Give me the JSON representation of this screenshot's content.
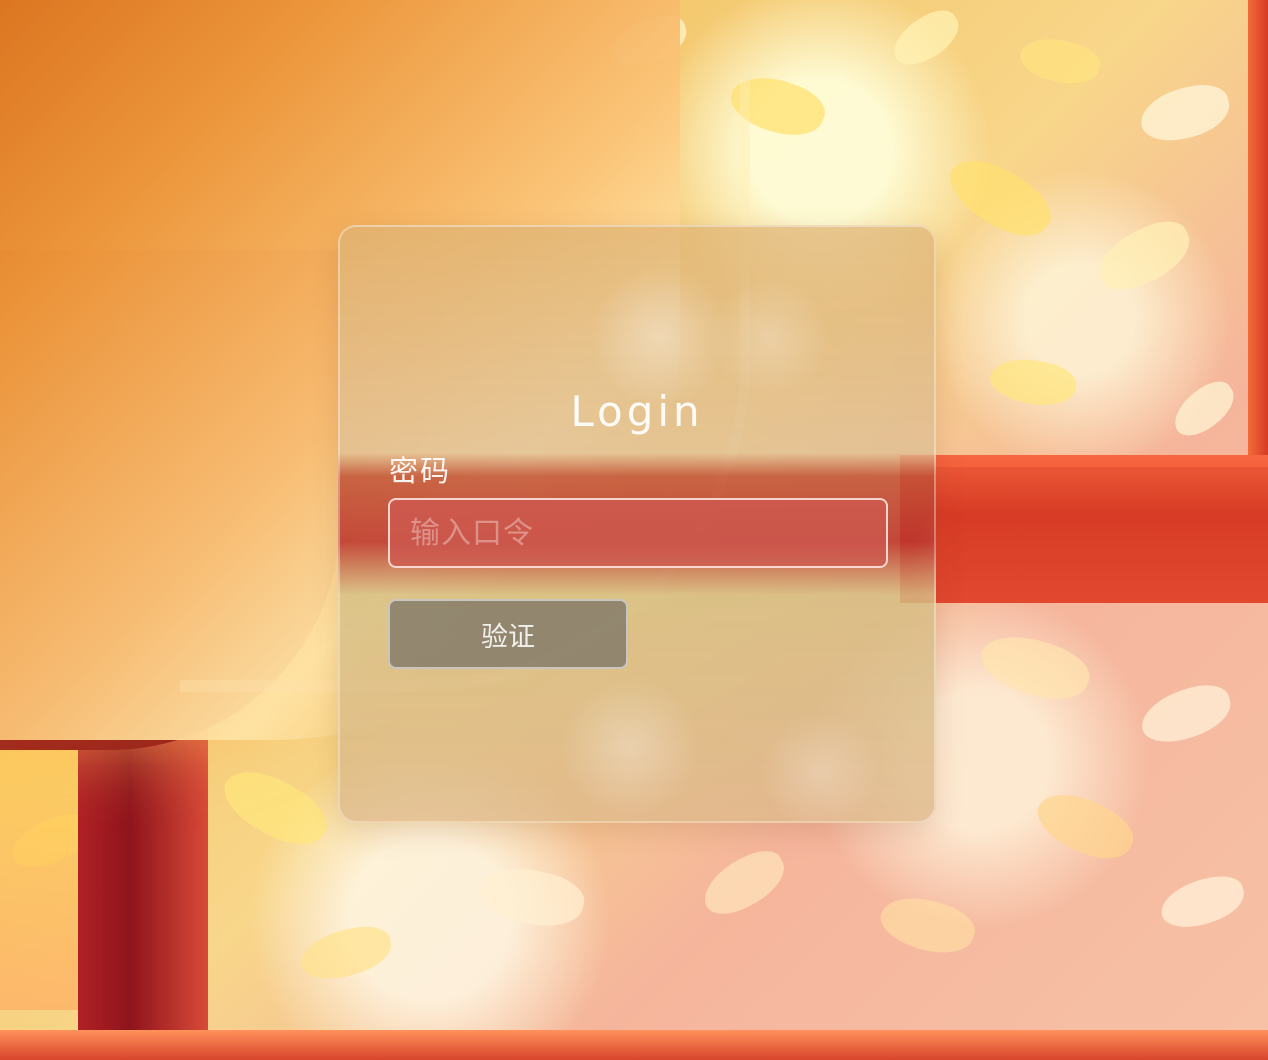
{
  "login": {
    "title": "Login",
    "password_label": "密码",
    "password_placeholder": "输入口令",
    "password_value": "",
    "verify_button_label": "验证"
  }
}
